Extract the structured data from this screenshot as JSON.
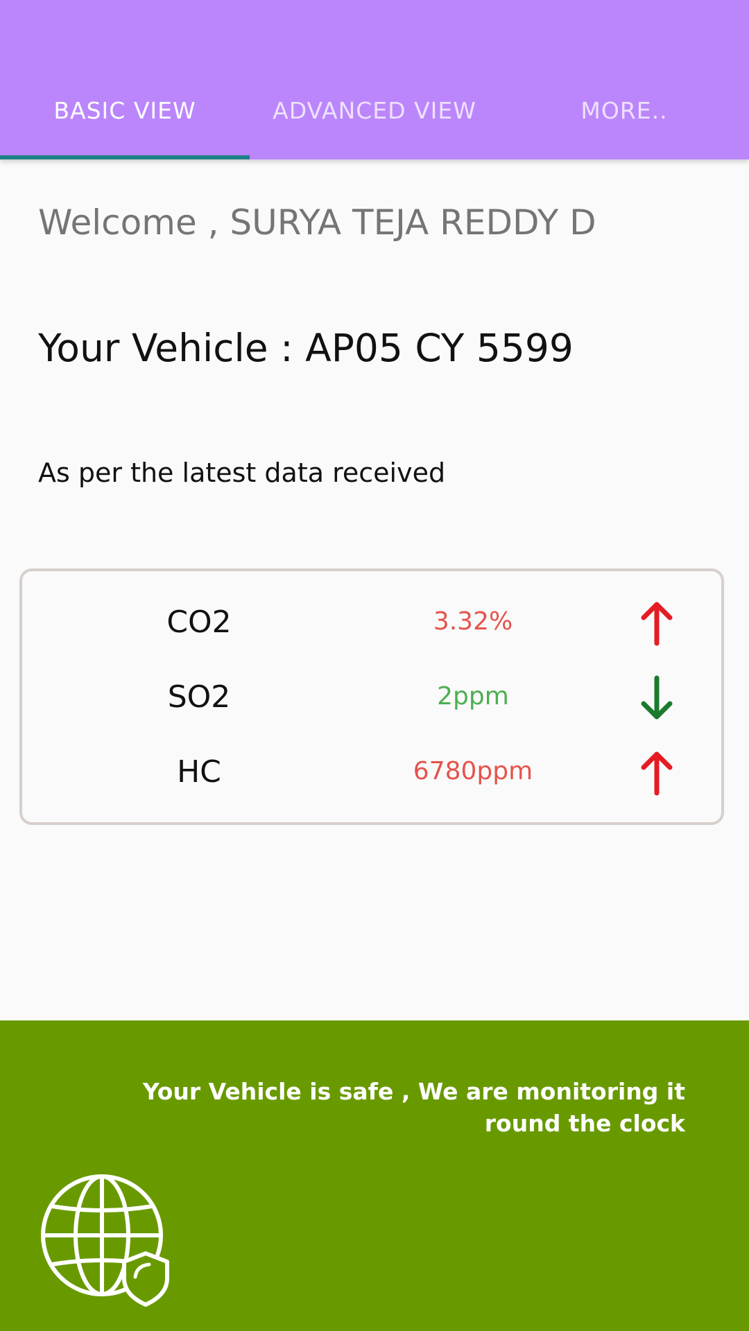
{
  "tabs": [
    {
      "label": "BASIC VIEW",
      "active": true
    },
    {
      "label": "ADVANCED VIEW",
      "active": false
    },
    {
      "label": "MORE..",
      "active": false
    }
  ],
  "greeting": "Welcome , SURYA TEJA REDDY D",
  "vehicle_line": "Your Vehicle : AP05 CY 5599",
  "data_note": "As per the latest data received",
  "readings": [
    {
      "name": "CO2",
      "value": "3.32%",
      "trend": "up",
      "value_color": "#e5534b",
      "arrow_color": "#e51c23",
      "arrow_icon": "arrow-up-icon"
    },
    {
      "name": "SO2",
      "value": "2ppm",
      "trend": "down",
      "value_color": "#4caf50",
      "arrow_color": "#1b7a2e",
      "arrow_icon": "arrow-down-icon"
    },
    {
      "name": "HC",
      "value": "6780ppm",
      "trend": "up",
      "value_color": "#e5534b",
      "arrow_color": "#e51c23",
      "arrow_icon": "arrow-up-icon"
    }
  ],
  "footer": {
    "message": "Your Vehicle is safe , We are monitoring it round the clock",
    "icon": "globe-shield-icon"
  },
  "colors": {
    "app_bar": "#bb86fc",
    "tab_indicator": "#1f7f86",
    "footer": "#689a00"
  }
}
